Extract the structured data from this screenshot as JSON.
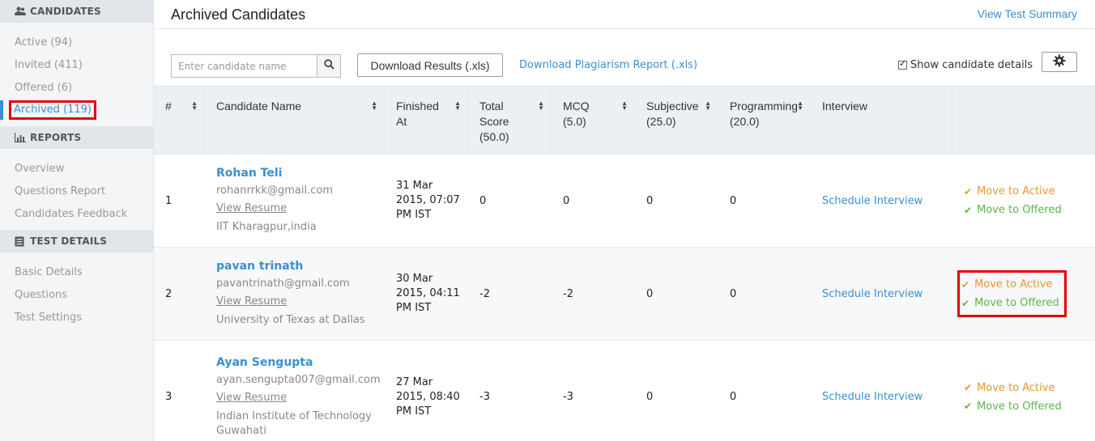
{
  "sidebar": {
    "sections": [
      {
        "title": "CANDIDATES",
        "icon": "users-icon",
        "items": [
          {
            "label": "Active (94)"
          },
          {
            "label": "Invited (411)"
          },
          {
            "label": "Offered (6)"
          },
          {
            "label": "Archived (119)",
            "active": true
          }
        ]
      },
      {
        "title": "REPORTS",
        "icon": "bar-chart-icon",
        "items": [
          {
            "label": "Overview"
          },
          {
            "label": "Questions Report"
          },
          {
            "label": "Candidates Feedback"
          }
        ]
      },
      {
        "title": "TEST DETAILS",
        "icon": "document-icon",
        "items": [
          {
            "label": "Basic Details"
          },
          {
            "label": "Questions"
          },
          {
            "label": "Test Settings"
          }
        ]
      }
    ]
  },
  "header": {
    "title": "Archived Candidates",
    "summary_link": "View Test Summary"
  },
  "toolbar": {
    "search_placeholder": "Enter candidate name",
    "download_results": "Download Results (.xls)",
    "download_plagiarism": "Download Plagiarism Report (.xls)",
    "show_details": "Show candidate details"
  },
  "table": {
    "headers": [
      "#",
      "Candidate Name",
      "Finished At",
      "Total Score (50.0)",
      "MCQ (5.0)",
      "Subjective (25.0)",
      "Programming (20.0)",
      "Interview",
      ""
    ],
    "rows": [
      {
        "num": "1",
        "name": "Rohan Teli",
        "email": "rohanrrkk@gmail.com",
        "resume": "View Resume",
        "school": "IIT Kharagpur,india",
        "finished": "31 Mar 2015, 07:07 PM IST",
        "total": "0",
        "mcq": "0",
        "subjective": "0",
        "programming": "0",
        "interview": "Schedule Interview",
        "move_active": "Move to Active",
        "move_offered": "Move to Offered"
      },
      {
        "num": "2",
        "name": "pavan trinath",
        "email": "pavantrinath@gmail.com",
        "resume": "View Resume",
        "school": "University of Texas at Dallas",
        "finished": "30 Mar 2015, 04:11 PM IST",
        "total": "-2",
        "mcq": "-2",
        "subjective": "0",
        "programming": "0",
        "interview": "Schedule Interview",
        "move_active": "Move to Active",
        "move_offered": "Move to Offered"
      },
      {
        "num": "3",
        "name": "Ayan Sengupta",
        "email": "ayan.sengupta007@gmail.com",
        "resume": "View Resume",
        "school": "Indian Institute of Technology Guwahati",
        "finished": "27 Mar 2015, 08:40 PM IST",
        "total": "-3",
        "mcq": "-3",
        "subjective": "0",
        "programming": "0",
        "interview": "Schedule Interview",
        "move_active": "Move to Active",
        "move_offered": "Move to Offered"
      }
    ]
  },
  "colors": {
    "link": "#3a8fd3",
    "orange": "#e8952f",
    "green": "#5fb34b",
    "highlight": "#e60000"
  }
}
